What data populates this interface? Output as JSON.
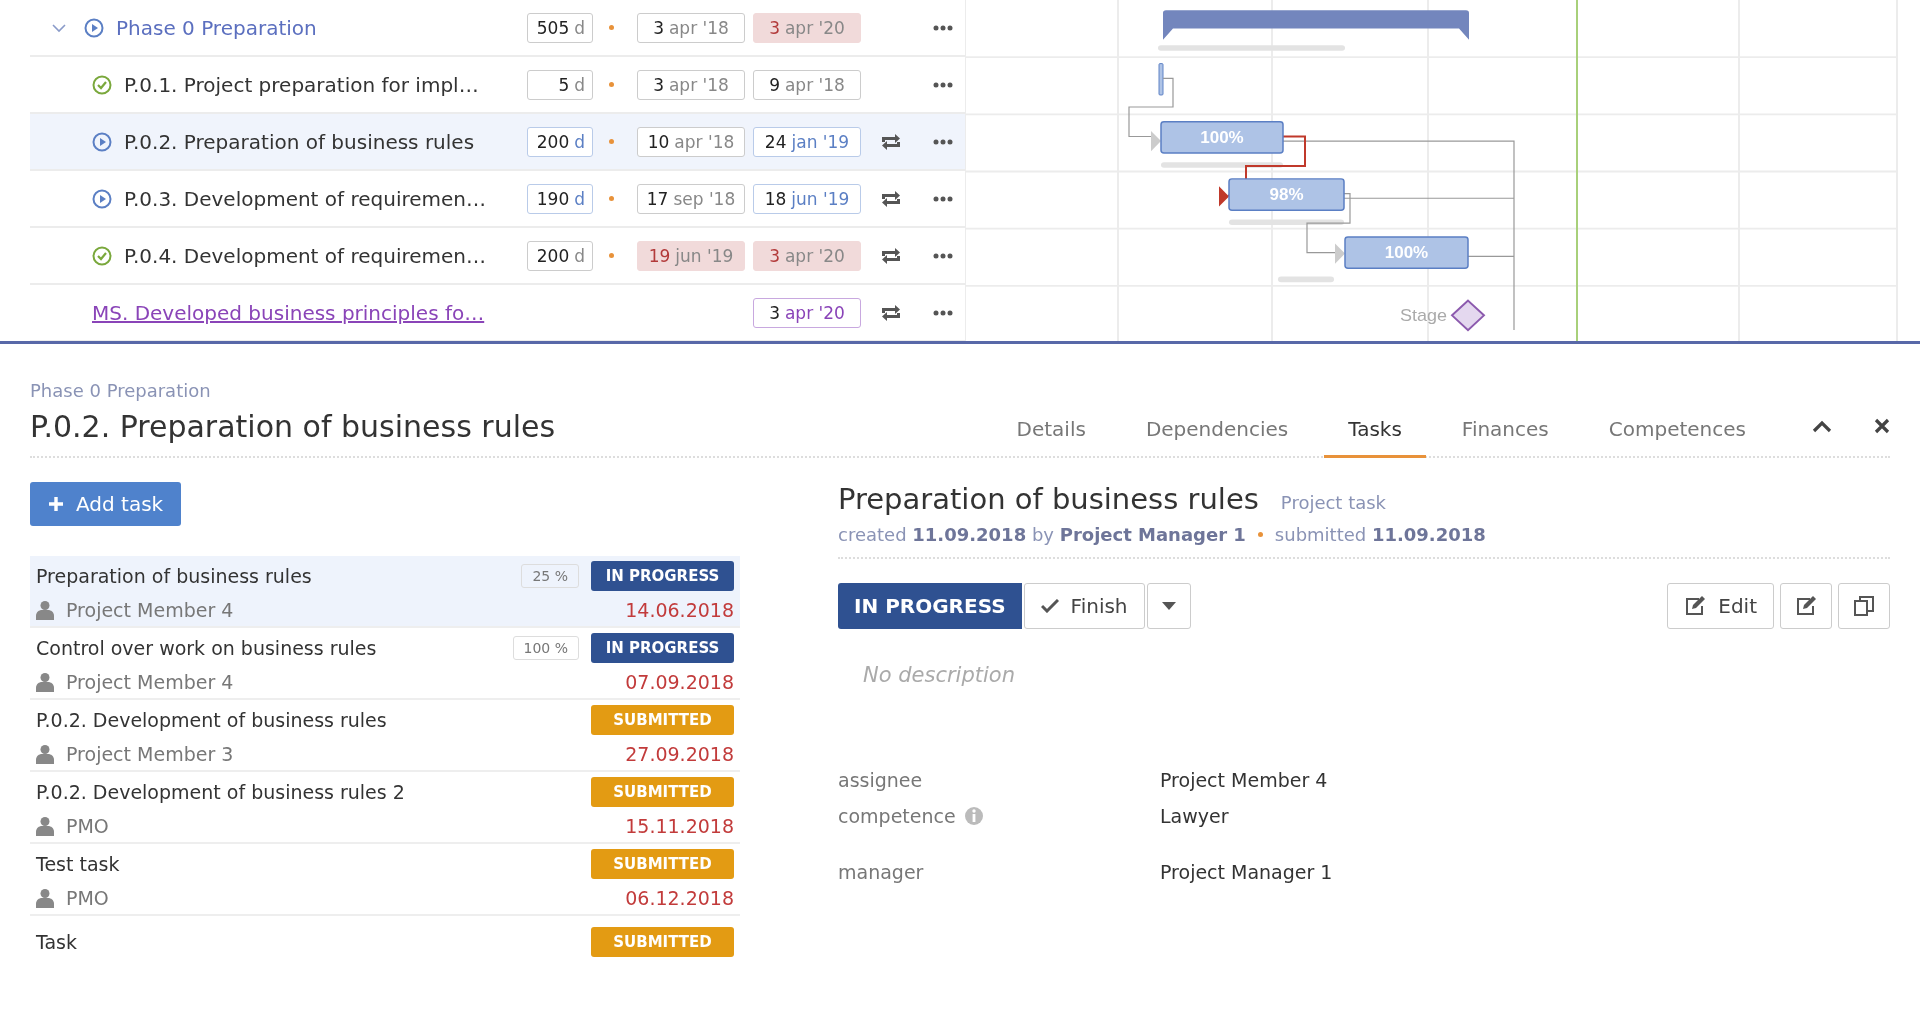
{
  "gantt": {
    "rows": [
      {
        "kind": "phase",
        "expanded": true,
        "done": false,
        "title": "Phase 0 Preparation",
        "duration": "505",
        "unit": "d",
        "start_day": "3",
        "start_month": "apr '18",
        "start_overdue": false,
        "end_day": "3",
        "end_month": "apr '20",
        "end_overdue": true,
        "end_planned": false,
        "recurring": false,
        "selected": false
      },
      {
        "kind": "task",
        "done": true,
        "title": "P.0.1. Project preparation for impl…",
        "duration": "5",
        "unit": "d",
        "start_day": "3",
        "start_month": "apr '18",
        "start_overdue": false,
        "end_day": "9",
        "end_month": "apr '18",
        "end_overdue": false,
        "end_planned": false,
        "recurring": false,
        "selected": false
      },
      {
        "kind": "task",
        "done": false,
        "title": "P.0.2. Preparation of business rules",
        "duration": "200",
        "unit": "d",
        "start_day": "10",
        "start_month": "apr '18",
        "start_overdue": false,
        "end_day": "24",
        "end_month": "jan '19",
        "end_overdue": false,
        "end_planned": true,
        "recurring": true,
        "selected": true
      },
      {
        "kind": "task",
        "done": false,
        "title": "P.0.3. Development of requiremen…",
        "duration": "190",
        "unit": "d",
        "start_day": "17",
        "start_month": "sep '18",
        "start_overdue": false,
        "end_day": "18",
        "end_month": "jun '19",
        "end_overdue": false,
        "end_planned": true,
        "recurring": true,
        "selected": false
      },
      {
        "kind": "task",
        "done": true,
        "title": "P.0.4. Development of requiremen…",
        "duration": "200",
        "unit": "d",
        "start_day": "19",
        "start_month": "jun '19",
        "start_overdue": true,
        "end_day": "3",
        "end_month": "apr '20",
        "end_overdue": true,
        "end_planned": false,
        "recurring": true,
        "selected": false
      },
      {
        "kind": "milestone",
        "title": "MS. Developed business principles fo…",
        "end_day": "3",
        "end_month": "apr '20",
        "recurring": true,
        "selected": false
      }
    ],
    "bars": [
      {
        "label": "100%"
      },
      {
        "label": "98%"
      },
      {
        "label": "100%"
      }
    ],
    "stage_label": "Stage"
  },
  "detail": {
    "breadcrumb": "Phase 0 Preparation",
    "title": "P.0.2. Preparation of business rules",
    "tabs": [
      {
        "label": "Details",
        "selected": false
      },
      {
        "label": "Dependencies",
        "selected": false
      },
      {
        "label": "Tasks",
        "selected": true
      },
      {
        "label": "Finances",
        "selected": false
      },
      {
        "label": "Competences",
        "selected": false
      }
    ],
    "add_task": "Add task",
    "tasks": [
      {
        "title": "Preparation of business rules",
        "progress": "25 %",
        "submitted": false,
        "status_label": "IN PROGRESS",
        "assignee": "Project Member 4",
        "due": "14.06.2018",
        "selected": true
      },
      {
        "title": "Control over work on business rules",
        "progress": "100 %",
        "submitted": false,
        "status_label": "IN PROGRESS",
        "assignee": "Project Member 4",
        "due": "07.09.2018",
        "selected": false
      },
      {
        "title": "P.0.2. Development of business rules",
        "submitted": true,
        "status_label": "SUBMITTED",
        "assignee": "Project Member 3",
        "due": "27.09.2018",
        "selected": false
      },
      {
        "title": "P.0.2. Development of business rules 2",
        "submitted": true,
        "status_label": "SUBMITTED",
        "assignee": "PMO",
        "due": "15.11.2018",
        "selected": false
      },
      {
        "title": "Test task",
        "submitted": true,
        "status_label": "SUBMITTED",
        "assignee": "PMO",
        "due": "06.12.2018",
        "selected": false
      },
      {
        "title": "Task",
        "submitted": true,
        "status_label": "SUBMITTED",
        "selected": false
      }
    ],
    "task": {
      "heading": "Preparation of business rules",
      "type": "Project task",
      "created": "created **11.09.2018** by **Project Manager 1**",
      "submitted": "submitted **11.09.2018**",
      "status_button": "IN PROGRESS",
      "finish_button": "Finish",
      "edit_button": "Edit",
      "placeholder": "No description",
      "field_groups": [
        [
          {
            "label": "assignee",
            "value": "Project Member 4",
            "info": false
          },
          {
            "label": "competence",
            "value": "Lawyer",
            "info": true
          }
        ],
        [
          {
            "label": "manager",
            "value": "Project Manager 1",
            "info": false
          }
        ]
      ]
    }
  }
}
